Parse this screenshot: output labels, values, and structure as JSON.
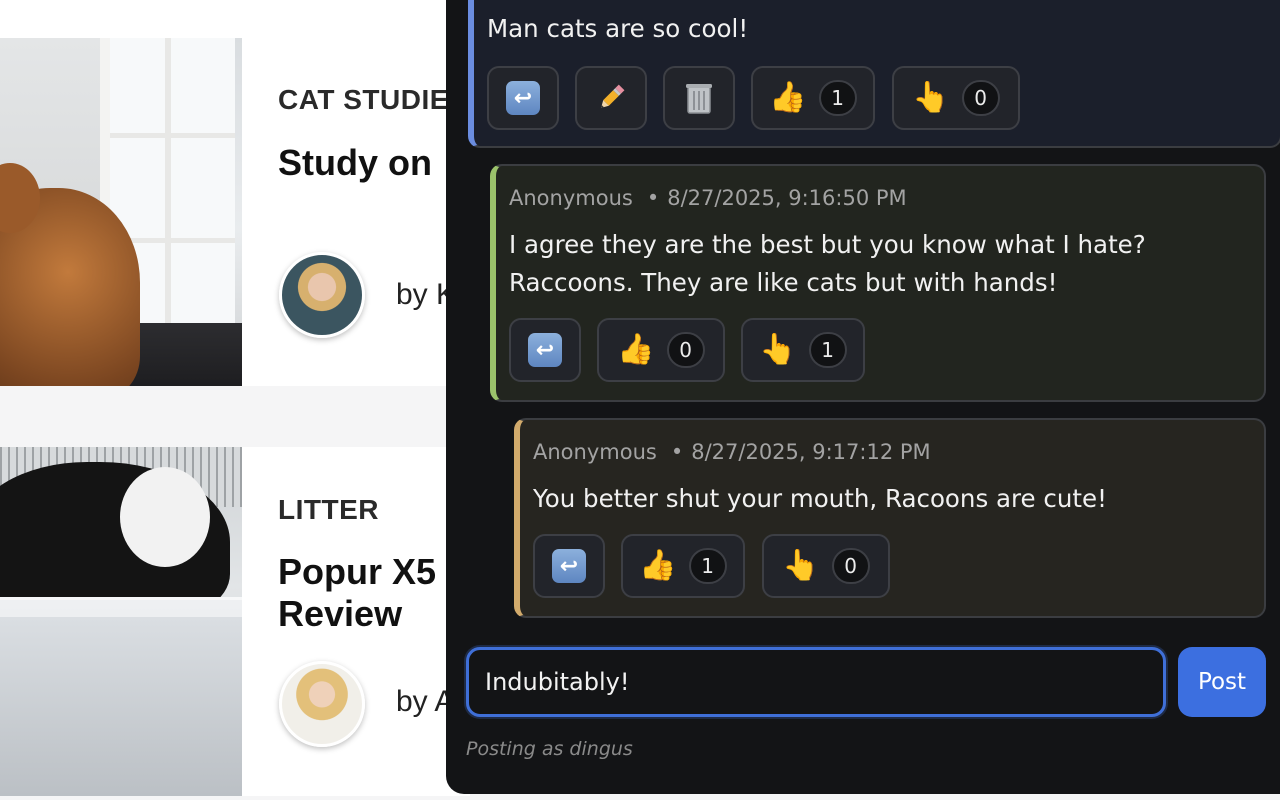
{
  "articles": [
    {
      "category": "CAT STUDIE",
      "title": "Study on",
      "byline": "by K"
    },
    {
      "category": "LITTER",
      "title": "Popur X5\nReview",
      "byline": "by A"
    }
  ],
  "comments": [
    {
      "text": "Man cats are so cool!",
      "reactions": {
        "thumbs_up": "1",
        "finger": "0"
      },
      "actions": [
        "reply-icon",
        "pencil-icon",
        "trash-icon"
      ]
    },
    {
      "author": "Anonymous",
      "separator": "•",
      "timestamp": "8/27/2025, 9:16:50 PM",
      "text": "I agree they are the best but you know what I hate? Raccoons. They are like cats but with hands!",
      "reactions": {
        "thumbs_up": "0",
        "finger": "1"
      },
      "actions": [
        "reply-icon"
      ]
    },
    {
      "author": "Anonymous",
      "separator": "•",
      "timestamp": "8/27/2025, 9:17:12 PM",
      "text": "You better shut your mouth, Racoons are cute!",
      "reactions": {
        "thumbs_up": "1",
        "finger": "0"
      },
      "actions": [
        "reply-icon"
      ]
    }
  ],
  "composer": {
    "value": "Indubitably!",
    "post_label": "Post",
    "posting_as": "Posting as dingus"
  },
  "emoji": {
    "reply": "↩",
    "pencil": "✏️",
    "trash": "🗑️",
    "thumbs_up": "👍",
    "finger": "👆"
  },
  "colors": {
    "accent_blue": "#3c6fe0",
    "thread_level_1": "#6b8de0",
    "thread_level_2": "#9bc26b",
    "thread_level_3": "#d2ab6c"
  }
}
